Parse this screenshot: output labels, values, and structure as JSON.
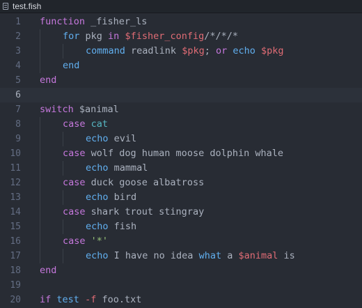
{
  "tab": {
    "title": "test.fish",
    "icon": "file-text-icon"
  },
  "colors": {
    "background": "#282c34",
    "keyword": "#c678dd",
    "function": "#61afef",
    "variable": "#e06c75",
    "string": "#98c379",
    "command": "#56b6c2",
    "text": "#abb2bf",
    "gutter": "#636d83"
  },
  "cursor_line": 6,
  "lines": [
    {
      "num": "1",
      "indent": 0,
      "tokens": [
        [
          "kw",
          "function"
        ],
        [
          "txt",
          " _fisher_ls"
        ]
      ]
    },
    {
      "num": "2",
      "indent": 1,
      "tokens": [
        [
          "fn",
          "for"
        ],
        [
          "txt",
          " pkg "
        ],
        [
          "kw",
          "in"
        ],
        [
          "txt",
          " "
        ],
        [
          "var",
          "$fisher_config"
        ],
        [
          "txt",
          "/*/*/*"
        ]
      ]
    },
    {
      "num": "3",
      "indent": 2,
      "tokens": [
        [
          "fn",
          "command"
        ],
        [
          "txt",
          " readlink "
        ],
        [
          "var",
          "$pkg"
        ],
        [
          "txt",
          "; "
        ],
        [
          "kw",
          "or"
        ],
        [
          "txt",
          " "
        ],
        [
          "fn",
          "echo"
        ],
        [
          "txt",
          " "
        ],
        [
          "var",
          "$pkg"
        ]
      ]
    },
    {
      "num": "4",
      "indent": 1,
      "tokens": [
        [
          "fn",
          "end"
        ]
      ]
    },
    {
      "num": "5",
      "indent": 0,
      "tokens": [
        [
          "kw",
          "end"
        ]
      ]
    },
    {
      "num": "6",
      "indent": 0,
      "tokens": []
    },
    {
      "num": "7",
      "indent": 0,
      "tokens": [
        [
          "kw",
          "switch"
        ],
        [
          "txt",
          " $animal"
        ]
      ]
    },
    {
      "num": "8",
      "indent": 1,
      "tokens": [
        [
          "kw",
          "case"
        ],
        [
          "txt",
          " "
        ],
        [
          "cmd",
          "cat"
        ]
      ]
    },
    {
      "num": "9",
      "indent": 2,
      "tokens": [
        [
          "fn",
          "echo"
        ],
        [
          "txt",
          " evil"
        ]
      ]
    },
    {
      "num": "10",
      "indent": 1,
      "tokens": [
        [
          "kw",
          "case"
        ],
        [
          "txt",
          " wolf dog human moose dolphin whale"
        ]
      ]
    },
    {
      "num": "11",
      "indent": 2,
      "tokens": [
        [
          "fn",
          "echo"
        ],
        [
          "txt",
          " mammal"
        ]
      ]
    },
    {
      "num": "12",
      "indent": 1,
      "tokens": [
        [
          "kw",
          "case"
        ],
        [
          "txt",
          " duck goose albatross"
        ]
      ]
    },
    {
      "num": "13",
      "indent": 2,
      "tokens": [
        [
          "fn",
          "echo"
        ],
        [
          "txt",
          " bird"
        ]
      ]
    },
    {
      "num": "14",
      "indent": 1,
      "tokens": [
        [
          "kw",
          "case"
        ],
        [
          "txt",
          " shark trout stingray"
        ]
      ]
    },
    {
      "num": "15",
      "indent": 2,
      "tokens": [
        [
          "fn",
          "echo"
        ],
        [
          "txt",
          " fish"
        ]
      ]
    },
    {
      "num": "16",
      "indent": 1,
      "tokens": [
        [
          "kw",
          "case"
        ],
        [
          "txt",
          " "
        ],
        [
          "str",
          "'*'"
        ]
      ]
    },
    {
      "num": "17",
      "indent": 2,
      "tokens": [
        [
          "fn",
          "echo"
        ],
        [
          "txt",
          " I have no idea "
        ],
        [
          "fn",
          "what"
        ],
        [
          "txt",
          " a "
        ],
        [
          "var",
          "$animal"
        ],
        [
          "txt",
          " is"
        ]
      ]
    },
    {
      "num": "18",
      "indent": 0,
      "tokens": [
        [
          "kw",
          "end"
        ]
      ]
    },
    {
      "num": "19",
      "indent": 0,
      "tokens": []
    },
    {
      "num": "20",
      "indent": 0,
      "tokens": [
        [
          "kw",
          "if"
        ],
        [
          "txt",
          " "
        ],
        [
          "fn",
          "test"
        ],
        [
          "txt",
          " "
        ],
        [
          "var",
          "-f"
        ],
        [
          "txt",
          " foo.txt"
        ]
      ]
    }
  ]
}
